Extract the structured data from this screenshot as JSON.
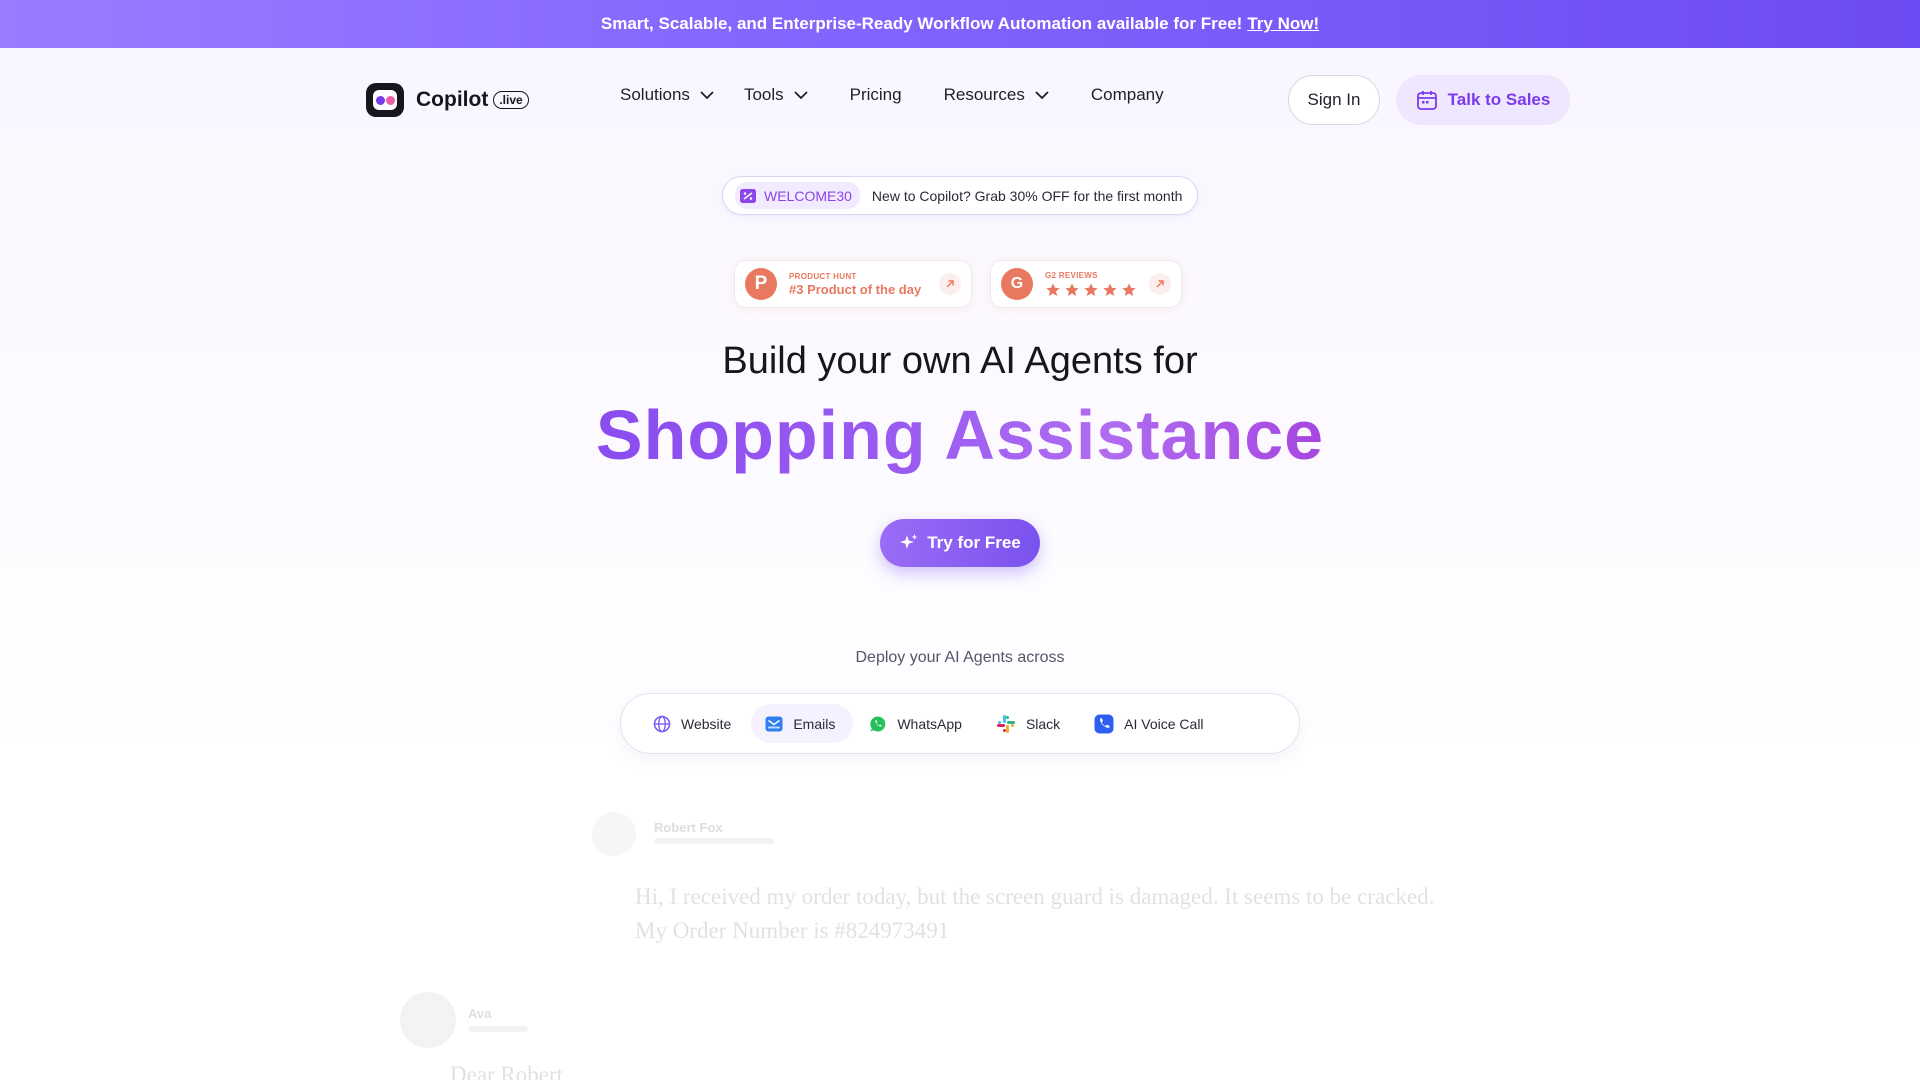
{
  "announcement": {
    "text": "Smart, Scalable, and Enterprise-Ready Workflow Automation available for Free!",
    "link": "Try Now!"
  },
  "brand": {
    "name": "Copilot",
    "suffix": ".live",
    "colors": {
      "primary": "#7c3aed",
      "accent_orange": "#e8785f"
    }
  },
  "nav": {
    "items": [
      {
        "label": "Solutions",
        "dropdown": true
      },
      {
        "label": "Tools",
        "dropdown": true
      },
      {
        "label": "Pricing",
        "dropdown": false
      },
      {
        "label": "Resources",
        "dropdown": true
      },
      {
        "label": "Company",
        "dropdown": false
      }
    ],
    "sign_in": "Sign In",
    "talk_to_sales": "Talk to Sales"
  },
  "promo": {
    "code": "WELCOME30",
    "text": "New to Copilot? Grab 30% OFF for the first month"
  },
  "badges": {
    "product_hunt": {
      "small": "PRODUCT HUNT",
      "big": "#3 Product of the day",
      "icon": "P"
    },
    "g2": {
      "small": "G2 REVIEWS",
      "rating": 5,
      "icon": "G"
    }
  },
  "hero": {
    "line1": "Build your own AI Agents for",
    "line2": "Shopping Assistance",
    "cta": "Try for Free"
  },
  "deploy": {
    "label": "Deploy your AI Agents across",
    "channels": [
      {
        "label": "Website",
        "icon": "globe-icon",
        "active": false
      },
      {
        "label": "Emails",
        "icon": "email-icon",
        "active": true
      },
      {
        "label": "WhatsApp",
        "icon": "whatsapp-icon",
        "active": false
      },
      {
        "label": "Slack",
        "icon": "slack-icon",
        "active": false
      },
      {
        "label": "AI Voice Call",
        "icon": "phone-icon",
        "active": false
      }
    ]
  },
  "chat_preview": {
    "sender1": "Robert Fox",
    "message": "Hi, I received my order today, but the screen guard is damaged. It seems to be cracked. My Order Number is #824973491",
    "sender2": "Ava",
    "reply_start": "Dear Robert"
  }
}
